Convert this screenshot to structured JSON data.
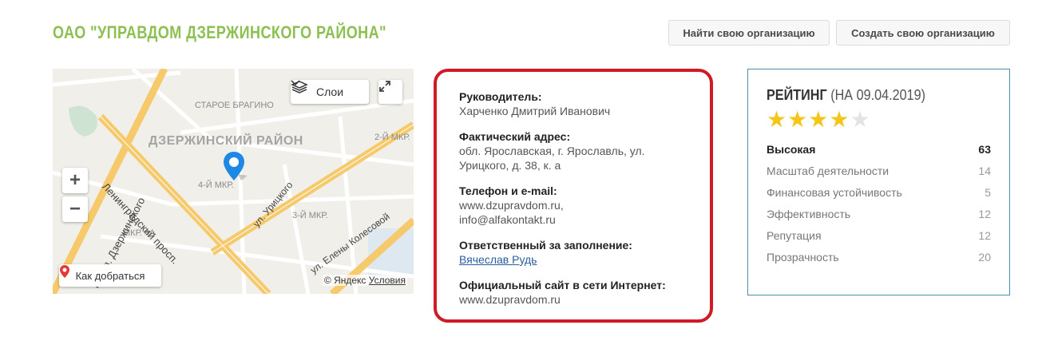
{
  "header": {
    "title": "ОАО \"УПРАВДОМ ДЗЕРЖИНСКОГО РАЙОНА\"",
    "find_org_label": "Найти свою организацию",
    "create_org_label": "Создать свою организацию"
  },
  "map": {
    "district_label": "ДЗЕРЖИНСКИЙ РАЙОН",
    "labels": {
      "staroe_bragino": "СТАРОЕ БРАГИНО",
      "mkr2": "2-Й МКР.",
      "mkr4": "4-Й МКР.",
      "mkr3": "3-Й МКР.",
      "mkr4a": "МКР. 4А",
      "leningradsky": "Ленинградский просп.",
      "dzerzhinsky": "просп. Дзержинского",
      "uritskogo": "ул. Урицкого",
      "kolesovoy": "ул. Елены Колесовой"
    },
    "layers_label": "Слои",
    "route_label": "Как добраться",
    "copyright": "© Яндекс",
    "terms_label": "Условия",
    "zoom_in": "+",
    "zoom_out": "−",
    "icons": [
      "layers-icon",
      "chevron-down-icon",
      "expand-icon",
      "location-pin-icon",
      "route-pin-icon"
    ],
    "colors": {
      "road_main": "#f6c96b",
      "road_minor": "#ffffff",
      "pin": "#1e88e5",
      "route_pin": "#e53935"
    }
  },
  "info": {
    "border_color": "#d01b26",
    "head_label": "Руководитель:",
    "head_value": "Харченко Дмитрий Иванович",
    "address_label": "Фактический адрес:",
    "address_line1": "обл. Ярославская, г. Ярославль, ул.",
    "address_line2": "Урицкого, д. 38, к. а",
    "contacts_label": "Телефон и e-mail:",
    "contacts_line1": "www.dzupravdom.ru,",
    "contacts_line2": "info@alfakontakt.ru",
    "responsible_label": "Ответственный за заполнение:",
    "responsible_value": "Вячеслав Рудь",
    "website_label": "Официальный сайт в сети Интернет:",
    "website_value": "www.dzupravdom.ru"
  },
  "rating": {
    "title_word": "РЕЙТИНГ",
    "title_date": "(НА 09.04.2019)",
    "stars_filled": 4,
    "stars_total": 5,
    "star_glyph": "★",
    "rows": [
      {
        "label": "Высокая",
        "value": "63"
      },
      {
        "label": "Масштаб деятельности",
        "value": "14"
      },
      {
        "label": "Финансовая устойчивость",
        "value": "5"
      },
      {
        "label": "Эффективность",
        "value": "12"
      },
      {
        "label": "Репутация",
        "value": "12"
      },
      {
        "label": "Прозрачность",
        "value": "20"
      }
    ]
  }
}
